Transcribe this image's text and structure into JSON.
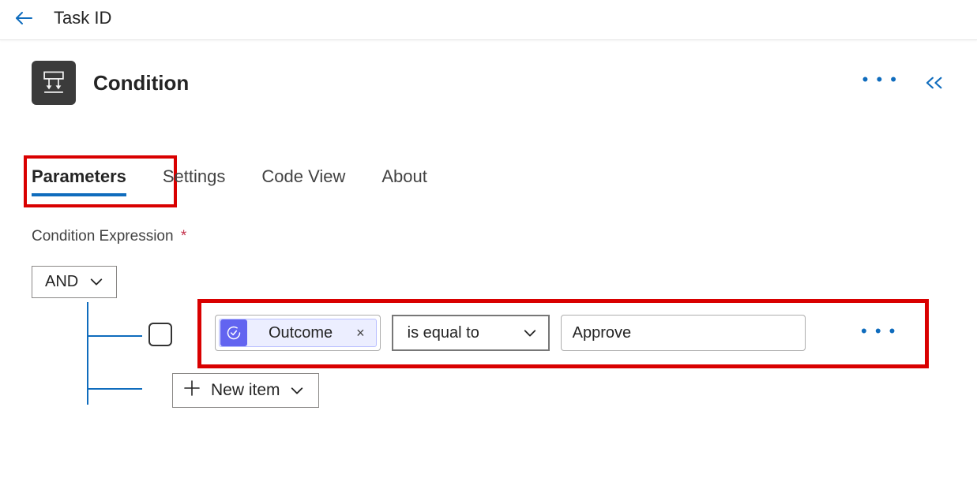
{
  "header": {
    "title": "Task ID"
  },
  "panel": {
    "title": "Condition",
    "icon_name": "condition-branch-icon"
  },
  "tabs": [
    {
      "label": "Parameters",
      "active": true
    },
    {
      "label": "Settings",
      "active": false
    },
    {
      "label": "Code View",
      "active": false
    },
    {
      "label": "About",
      "active": false
    }
  ],
  "section": {
    "label": "Condition Expression",
    "required_mark": "*"
  },
  "expression": {
    "group_operator": "AND",
    "row": {
      "left_token": "Outcome",
      "left_token_close": "×",
      "operator": "is equal to",
      "value": "Approve"
    },
    "new_item_label": "New item"
  },
  "colors": {
    "accent": "#0f6cbd",
    "highlight_border": "#d90000",
    "token_bg": "#6264f0"
  }
}
